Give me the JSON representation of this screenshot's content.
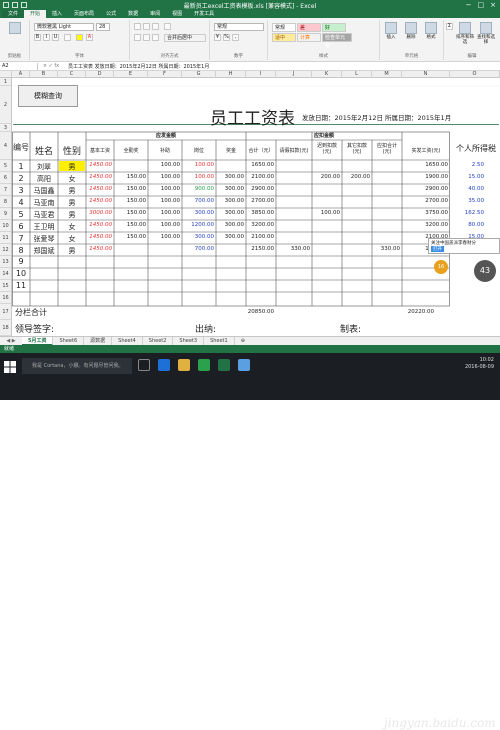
{
  "window": {
    "title": "最新员工excel工资表模板.xls [兼容模式] - Excel",
    "tabs": [
      "文件",
      "开始",
      "插入",
      "页面布局",
      "公式",
      "数据",
      "审阅",
      "视图",
      "开发工具"
    ]
  },
  "ribbon": {
    "font_name": "微软雅黑 Light",
    "font_size": "28",
    "number_format": "常规",
    "align_label": "合并后居中",
    "styles": [
      "常规",
      "差",
      "好",
      "适中",
      "计算",
      "检查单元格"
    ],
    "big_buttons": [
      "条件格式",
      "套用表格格式",
      "插入",
      "删除",
      "格式",
      "排序和筛选",
      "查找和选择"
    ],
    "groups": [
      "剪贴板",
      "字体",
      "对齐方式",
      "数字",
      "样式",
      "单元格",
      "编辑"
    ]
  },
  "formula_bar": {
    "name_box": "A2",
    "formula": "员工工资表    发放日期：2015年2月12日  所属日期：2015年1月"
  },
  "columns": [
    "A",
    "B",
    "C",
    "D",
    "E",
    "F",
    "G",
    "H",
    "I",
    "J",
    "K",
    "L",
    "M",
    "N",
    "O"
  ],
  "rows": [
    "1",
    "2",
    "3",
    "4",
    "5",
    "6",
    "7",
    "8",
    "9",
    "10",
    "11",
    "12",
    "13",
    "14",
    "15",
    "16",
    "17",
    "18"
  ],
  "sheet": {
    "query_button": "模糊查询",
    "title": "员工工资表",
    "subtitle": "发放日期：2015年2月12日  所属日期：2015年1月",
    "group_payable": "应发金额",
    "group_deduct": "应扣金额",
    "headers": {
      "no": "编号",
      "name": "姓名",
      "gender": "性别",
      "base": "基本工资",
      "allowance": "全勤奖",
      "subsidy": "补助",
      "post": "岗位",
      "bonus": "奖金",
      "total": "合计（元）",
      "leave": "请假扣款(元)",
      "late": "迟到扣款(元)",
      "other": "其它扣款(元)",
      "deduct_total": "应扣合计(元)",
      "actual": "实发工资(元)",
      "tax": "个人所得税"
    },
    "employees": [
      {
        "no": "1",
        "name": "刘翠",
        "gender": "男",
        "base": "1450.00",
        "allowance": "",
        "subsidy": "100.00",
        "post": "100.00",
        "bonus": "",
        "total": "1650.00",
        "leave": "",
        "late": "",
        "other": "",
        "deduct": "",
        "actual": "1650.00",
        "tax": "2.50"
      },
      {
        "no": "2",
        "name": "高阳",
        "gender": "女",
        "base": "1450.00",
        "allowance": "150.00",
        "subsidy": "100.00",
        "post": "100.00",
        "bonus": "300.00",
        "total": "2100.00",
        "leave": "",
        "late": "200.00",
        "other": "200.00",
        "deduct": "",
        "actual": "1900.00",
        "tax": "15.00"
      },
      {
        "no": "3",
        "name": "马国鑫",
        "gender": "男",
        "base": "1450.00",
        "allowance": "150.00",
        "subsidy": "100.00",
        "post": "900.00",
        "bonus": "300.00",
        "total": "2900.00",
        "leave": "",
        "late": "",
        "other": "",
        "deduct": "",
        "actual": "2900.00",
        "tax": "40.00"
      },
      {
        "no": "4",
        "name": "马亚南",
        "gender": "男",
        "base": "1450.00",
        "allowance": "150.00",
        "subsidy": "100.00",
        "post": "700.00",
        "bonus": "300.00",
        "total": "2700.00",
        "leave": "",
        "late": "",
        "other": "",
        "deduct": "",
        "actual": "2700.00",
        "tax": "35.00"
      },
      {
        "no": "5",
        "name": "马亚君",
        "gender": "男",
        "base": "3000.00",
        "allowance": "150.00",
        "subsidy": "100.00",
        "post": "300.00",
        "bonus": "300.00",
        "total": "3850.00",
        "leave": "",
        "late": "100.00",
        "other": "",
        "deduct": "",
        "actual": "3750.00",
        "tax": "162.50"
      },
      {
        "no": "6",
        "name": "王卫明",
        "gender": "女",
        "base": "1450.00",
        "allowance": "150.00",
        "subsidy": "100.00",
        "post": "1200.00",
        "bonus": "300.00",
        "total": "3200.00",
        "leave": "",
        "late": "",
        "other": "",
        "deduct": "",
        "actual": "3200.00",
        "tax": "80.00"
      },
      {
        "no": "7",
        "name": "张爱琴",
        "gender": "女",
        "base": "1450.00",
        "allowance": "150.00",
        "subsidy": "100.00",
        "post": "300.00",
        "bonus": "300.00",
        "total": "2100.00",
        "leave": "",
        "late": "",
        "other": "",
        "deduct": "",
        "actual": "2100.00",
        "tax": "15.00"
      },
      {
        "no": "8",
        "name": "郑国斌",
        "gender": "男",
        "base": "1450.00",
        "allowance": "",
        "subsidy": "",
        "post": "700.00",
        "bonus": "",
        "total": "2150.00",
        "leave": "330.00",
        "late": "",
        "other": "",
        "deduct": "330.00",
        "actual": "1820.00",
        "tax": ""
      }
    ],
    "empty_rows": [
      "9",
      "10",
      "11"
    ],
    "subtotal_label": "分栏合计",
    "subtotal_total": "20850.00",
    "subtotal_actual": "20220.00",
    "sign_leader": "领导签字:",
    "sign_cashier": "出纳:",
    "sign_maker": "制表:"
  },
  "sheet_tabs": [
    "5月工资",
    "Sheet6",
    "源数据",
    "Sheet4",
    "Sheet2",
    "Sheet3",
    "Sheet1"
  ],
  "status": "就绪",
  "taskbar": {
    "search_placeholder": "我是 Cortana，小娜。有问题尽管问我。",
    "time": "10:02",
    "date": "2016-08-09"
  },
  "popup": {
    "text": "关注中国盖派李春财分",
    "action": "打开"
  },
  "badges": {
    "level": "16",
    "percent": "43"
  },
  "watermark": "jingyan.baidu.com",
  "colors": {
    "excel_green": "#217346",
    "accent_red": "#e03030",
    "accent_blue": "#2040c0",
    "name_highlight": "#fff000"
  }
}
